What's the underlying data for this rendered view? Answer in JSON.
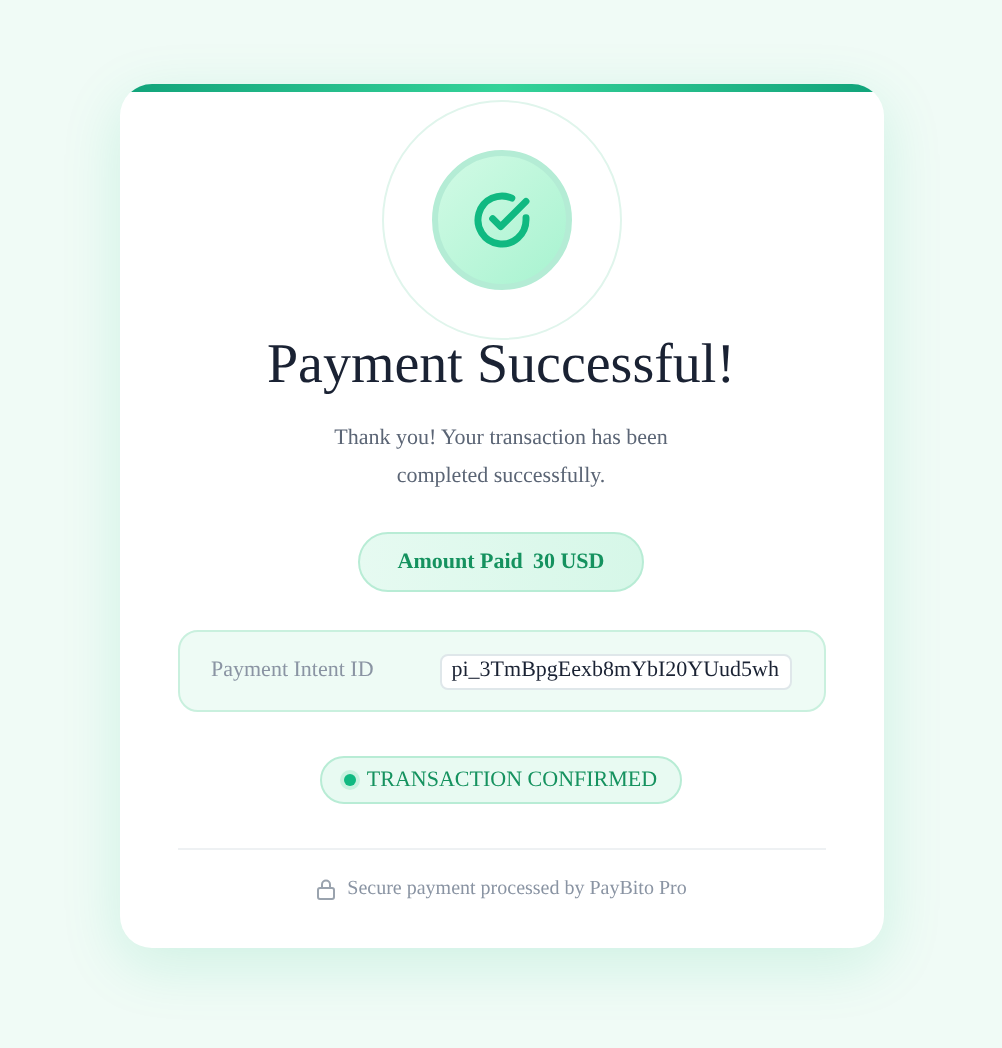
{
  "title": "Payment Successful!",
  "message": "Thank you! Your transaction has been completed successfully.",
  "amount": {
    "label": "Amount Paid",
    "value": "30 USD"
  },
  "payment_intent": {
    "label": "Payment Intent ID",
    "value": "pi_3TmBpgEexb8mYbI20YUud5wh"
  },
  "status": {
    "text": "TRANSACTION CONFIRMED",
    "color": "#10b981"
  },
  "footer": "Secure payment processed by PayBito Pro"
}
